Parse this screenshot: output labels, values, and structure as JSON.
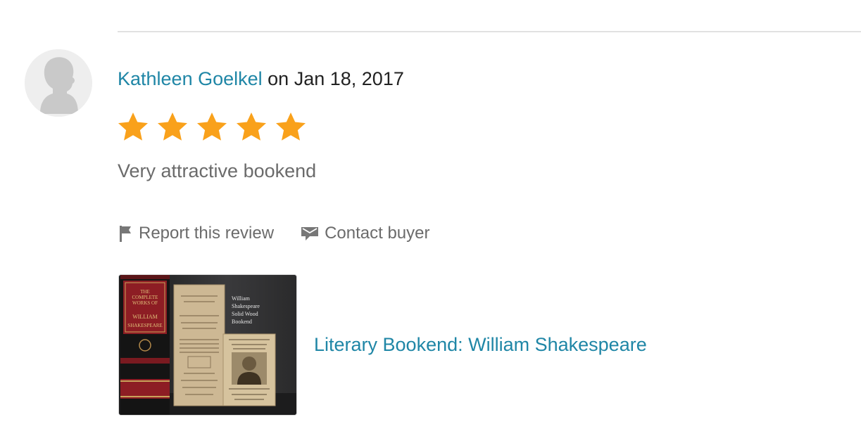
{
  "review": {
    "reviewer_name": "Kathleen Goelkel",
    "date_prefix": "on",
    "date": "Jan 18, 2017",
    "rating": 5,
    "rating_max": 5,
    "text": "Very attractive bookend"
  },
  "actions": {
    "report_label": "Report this review",
    "contact_label": "Contact buyer"
  },
  "listing": {
    "title": "Literary Bookend: William Shakespeare",
    "image_text": {
      "book_title_1": "THE",
      "book_title_2": "COMPLETE",
      "book_title_3": "WORKS OF",
      "book_author_1": "WILLIAM",
      "book_author_2": "SHAKESPEARE",
      "tag_line_1": "William",
      "tag_line_2": "Shakespeare",
      "tag_line_3": "Solid Wood",
      "tag_line_4": "Bookend"
    }
  },
  "colors": {
    "link": "#1f86a6",
    "star": "#f9a11b",
    "muted_text": "#6b6b6b"
  },
  "icons": {
    "report": "flag-icon",
    "contact": "message-icon"
  }
}
